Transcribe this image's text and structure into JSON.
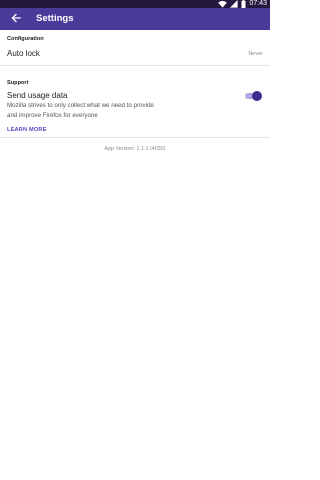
{
  "status_bar": {
    "time": "07:43",
    "icons": [
      "wifi-icon",
      "cell-signal-icon",
      "battery-icon"
    ]
  },
  "app_bar": {
    "title": "Settings",
    "back_icon": "arrow-left-icon"
  },
  "sections": {
    "configuration": {
      "header": "Configuration",
      "auto_lock": {
        "label": "Auto lock",
        "value": "Never"
      }
    },
    "support": {
      "header": "Support",
      "usage_data": {
        "label": "Send usage data",
        "description": "Mozilla strives to only collect what we need to provide and improve Firefox for everyone",
        "toggle_on": true,
        "learn_more": "LEARN MORE"
      }
    }
  },
  "footer": {
    "version": "App Version: 1.1.1 (4030)"
  },
  "colors": {
    "app_bar": "#4c3a9a",
    "status_bar": "#24183f",
    "accent": "#5b3fc4",
    "toggle_thumb": "#3b2d8f",
    "toggle_track": "#b3a7e3"
  }
}
